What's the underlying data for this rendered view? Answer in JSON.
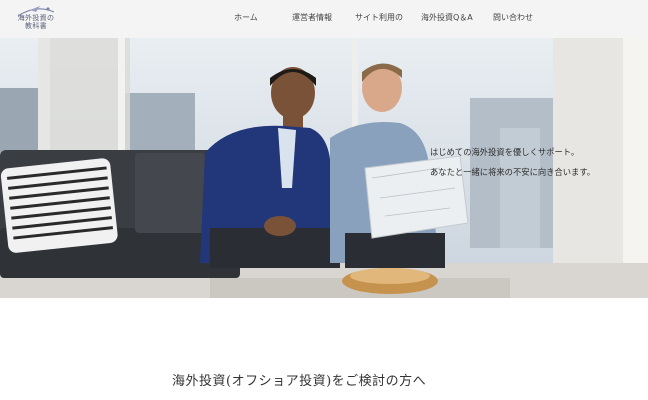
{
  "brand": {
    "logo_text": "海外投資の教科書"
  },
  "nav": {
    "items": [
      {
        "label": "ホーム"
      },
      {
        "label": "運営者情報"
      },
      {
        "label": "サイト利用の"
      },
      {
        "label": "海外投資Q＆A"
      },
      {
        "label": "問い合わせ"
      }
    ]
  },
  "hero": {
    "tagline_line1": "はじめての海外投資を優しくサポート。",
    "tagline_line2": "あなたと一緒に将来の不安に向き合います。"
  },
  "section": {
    "title": "海外投資(オフショア投資)をご検討の方へ"
  },
  "colors": {
    "header_bg": "#f4f4f4",
    "accent": "#5a5f7a"
  }
}
